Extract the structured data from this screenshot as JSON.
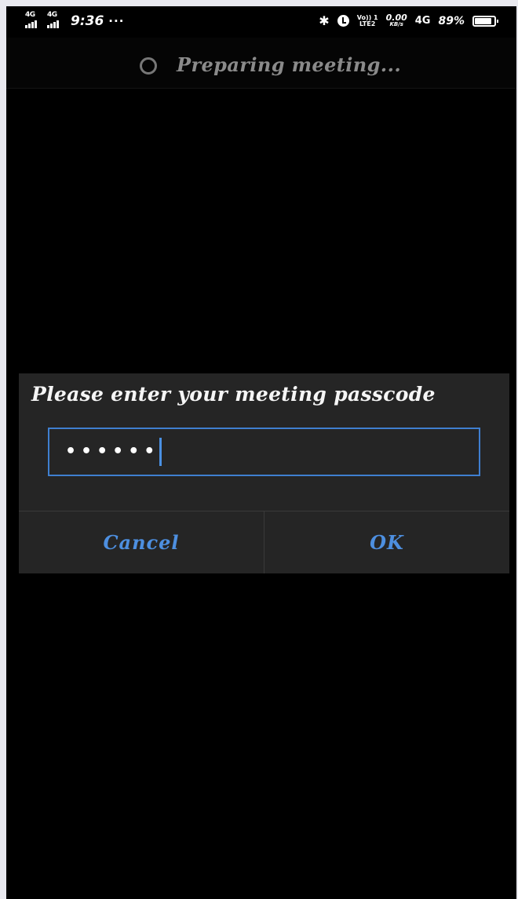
{
  "status_bar": {
    "sim1_network": "4G",
    "sim2_network": "4G",
    "time": "9:36",
    "more": "···",
    "volte_top": "Vo)) 1",
    "volte_bottom": "LTE2",
    "speed_value": "0.00",
    "speed_unit": "KB/s",
    "network_right": "4G",
    "battery_percent": "89%",
    "battery_level": 0.89
  },
  "title_bar": {
    "title": "Preparing meeting..."
  },
  "dialog": {
    "title": "Please enter your meeting passcode",
    "passcode_masked": "••••••",
    "cancel_label": "Cancel",
    "ok_label": "OK",
    "accent_color": "#4d8fe0"
  }
}
